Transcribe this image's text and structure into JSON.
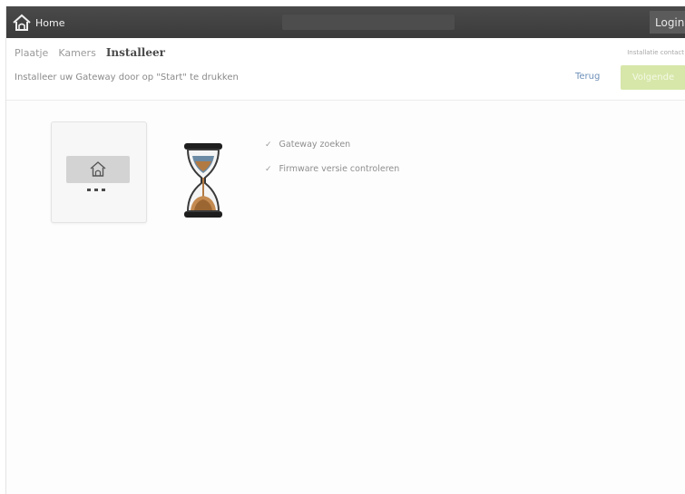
{
  "topbar": {
    "home_label": "Home",
    "login_label": "Login"
  },
  "tabs": [
    {
      "label": "Plaatje"
    },
    {
      "label": "Kamers"
    },
    {
      "label": "Installeer"
    }
  ],
  "support_link": "Installatie contact",
  "instruction": "Installeer uw Gateway door op \"Start\" te drukken",
  "actions": {
    "back_label": "Terug",
    "next_label": "Volgende"
  },
  "checklist": [
    {
      "label": "Gateway zoeken"
    },
    {
      "label": "Firmware versie controleren"
    }
  ],
  "icons": {
    "home": "home-icon",
    "hourglass": "hourglass-icon",
    "check": "check-icon",
    "gateway": "gateway-device-icon"
  },
  "colors": {
    "topbar": "#3f3f3f",
    "accent_button": "#d7e7a9",
    "link": "#6d8fb8"
  }
}
